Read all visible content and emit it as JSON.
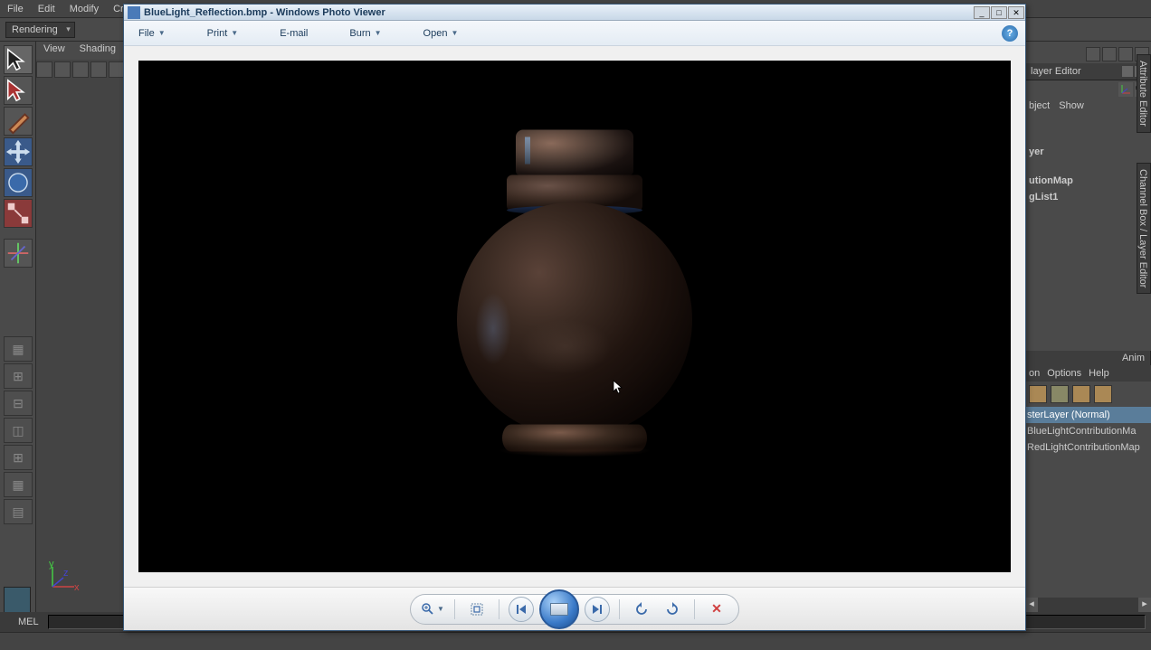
{
  "maya": {
    "menubar": [
      "File",
      "Edit",
      "Modify",
      "Cre"
    ],
    "workspace": "Rendering",
    "viewTabs": [
      "View",
      "Shading"
    ],
    "cmdLabel": "MEL"
  },
  "rightPanel": {
    "title1": "layer Editor",
    "objectMenu": "bject",
    "showMenu": "Show",
    "items": [
      "yer",
      "utionMap",
      "gList1"
    ],
    "animTab": "Anim",
    "optionsMenu": [
      "on",
      "Options",
      "Help"
    ],
    "layers": [
      {
        "name": "sterLayer (Normal)",
        "selected": true
      },
      {
        "name": "BlueLightContributionMa",
        "selected": false
      },
      {
        "name": "RedLightContributionMap",
        "selected": false
      }
    ]
  },
  "sideTabs": {
    "attr": "Attribute Editor",
    "chan": "Channel Box / Layer Editor"
  },
  "photoViewer": {
    "title": "BlueLight_Reflection.bmp - Windows Photo Viewer",
    "menus": {
      "file": "File",
      "print": "Print",
      "email": "E-mail",
      "burn": "Burn",
      "open": "Open"
    },
    "controls": {
      "zoom": "zoom",
      "fit": "fit",
      "prev": "previous",
      "play": "slideshow",
      "next": "next",
      "rotateCCW": "rotate-ccw",
      "rotateCW": "rotate-cw",
      "delete": "delete"
    }
  }
}
